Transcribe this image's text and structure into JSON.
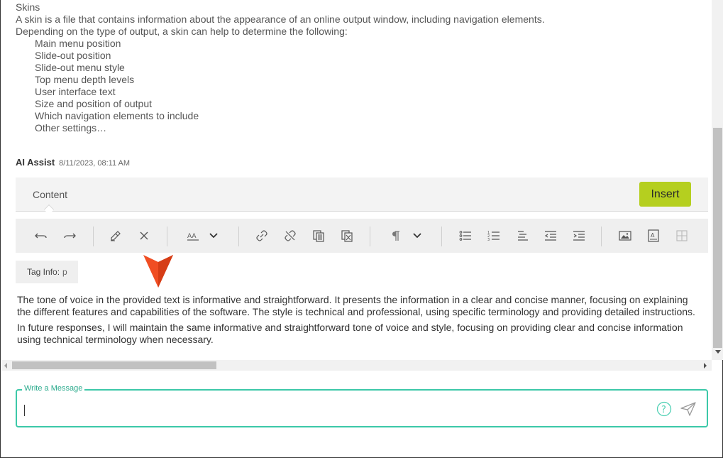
{
  "previous_message": {
    "heading": "Skins",
    "lines": [
      "A skin is a file that contains information about the appearance of an online output window, including navigation elements.",
      "Depending on the type of output, a skin can help to determine the following:"
    ],
    "bullet_glyph": "",
    "bullets": [
      "Main menu position",
      "Slide-out position",
      "Slide-out menu style",
      "Top menu depth levels",
      "User interface text",
      "Size and position of output",
      "Which navigation elements to include",
      "Other settings…"
    ]
  },
  "message_header": {
    "author": "AI Assist",
    "timestamp": "8/11/2023, 08:11 AM"
  },
  "tabbar": {
    "tab_label": "Content",
    "insert_label": "Insert",
    "insert_color": "#b5cf1f"
  },
  "toolbar": {
    "icons": [
      "undo-icon",
      "redo-icon",
      "clear-format-icon",
      "remove-icon",
      "font-size-icon",
      "font-size-dropdown-icon",
      "link-icon",
      "unlink-icon",
      "copy-format-icon",
      "remove-format-icon",
      "paragraph-icon",
      "paragraph-dropdown-icon",
      "bulleted-list-icon",
      "numbered-list-icon",
      "align-list-icon",
      "outdent-icon",
      "indent-icon",
      "image-icon",
      "insert-field-icon",
      "table-icon"
    ]
  },
  "tag_info": {
    "label": "Tag Info:",
    "value": "p"
  },
  "response": {
    "paragraphs": [
      "The tone of voice in the provided text is informative and straightforward. It presents the information in a clear and concise manner, focusing on explaining the different features and capabilities of the software. The style is technical and professional, using specific terminology and providing detailed instructions.",
      "In future responses, I will maintain the same informative and straightforward tone of voice and style, focusing on providing clear and concise information using technical terminology when necessary."
    ]
  },
  "composer": {
    "label": "Write a Message",
    "value": "",
    "accent_color": "#3cc8a8"
  },
  "colors": {
    "pointer": "#f04e23"
  }
}
